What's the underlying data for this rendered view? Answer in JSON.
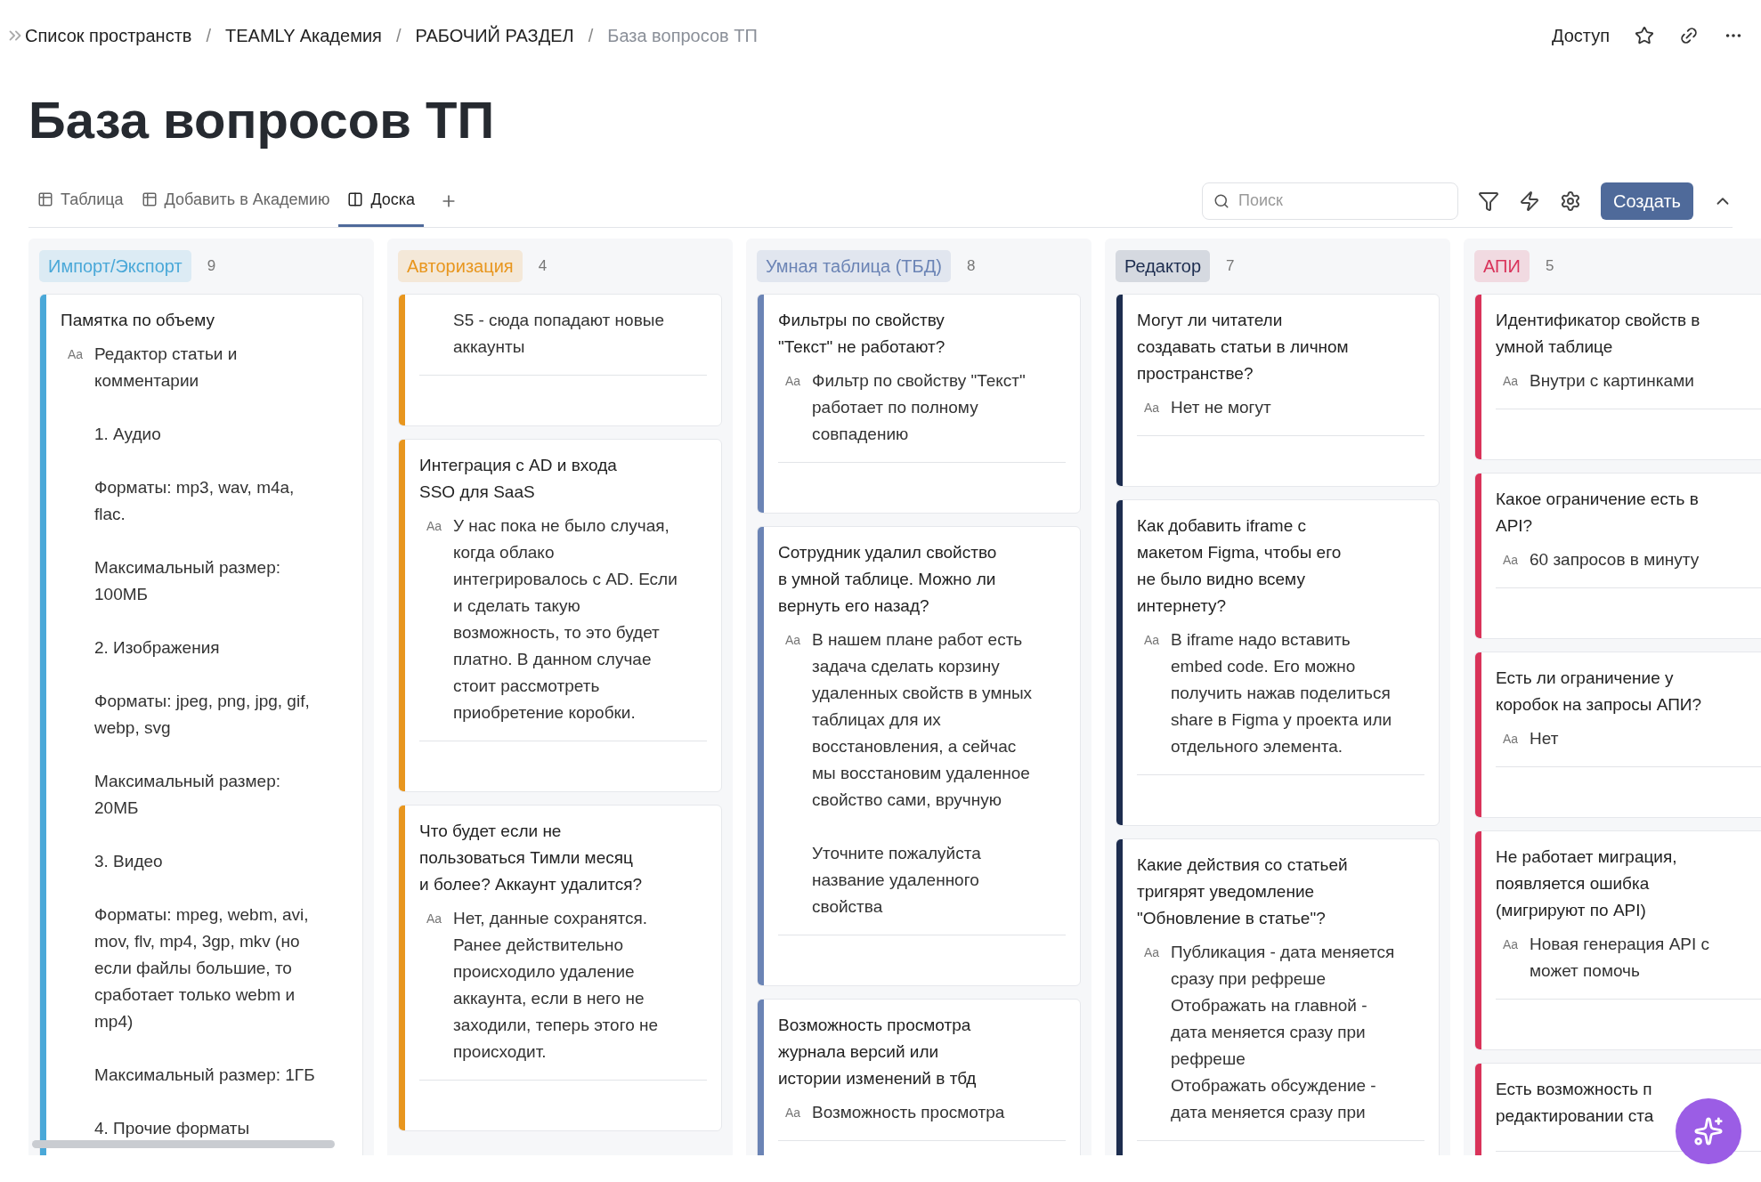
{
  "breadcrumbs": [
    {
      "label": "Список пространств",
      "current": false
    },
    {
      "label": "TEAMLY Академия",
      "current": false
    },
    {
      "label": "РАБОЧИЙ РАЗДЕЛ",
      "current": false
    },
    {
      "label": "База вопросов ТП",
      "current": true
    }
  ],
  "breadcrumb_separator": "/",
  "header_actions": {
    "access": "Доступ"
  },
  "title": "База вопросов ТП",
  "views": [
    {
      "label": "Таблица",
      "kind": "table",
      "selected": false
    },
    {
      "label": "Добавить в Академию",
      "kind": "table",
      "selected": false
    },
    {
      "label": "Доска",
      "kind": "board",
      "selected": true
    }
  ],
  "search": {
    "placeholder": "Поиск"
  },
  "create_button": "Создать",
  "columns": [
    {
      "label": "Импорт/Экспорт",
      "count": "9",
      "color": "#4aa8d8",
      "cards": [
        {
          "title": "Памятка по объему",
          "prop": "Aa",
          "body": "Редактор статьи и\nкомментарии\n\n1. Аудио\n\nФорматы: mp3, wav, m4a,\nflac.\n\nМаксимальный размер:\n100МБ\n\n2. Изображения\n\nФорматы: jpeg, png, jpg, gif,\nwebp, svg\n\nМаксимальный размер:\n20МБ\n\n3. Видео\n\nФорматы: mpeg, webm, avi,\nmov, flv, mp4, 3gp, mkv (но\nесли файлы большие, то\nсработает только webm и\nmp4)\n\nМаксимальный размер: 1ГБ\n\n4. Прочие форматы"
        }
      ]
    },
    {
      "label": "Авторизация",
      "count": "4",
      "color": "#e8961e",
      "cards": [
        {
          "body": "S5 - сюда попадают новые\nаккаунты"
        },
        {
          "title": "Интеграция с AD и входа\nSSO для SaaS",
          "prop": "Aa",
          "body": "У нас пока не было случая,\nкогда облако\nинтегрировалось с AD. Если\nи сделать такую\nвозможность, то это будет\nплатно. В данном случае\nстоит рассмотреть\nприобретение коробки."
        },
        {
          "title": "Что будет если не\nпользоваться Тимли месяц\nи более? Аккаунт удалится?",
          "prop": "Aa",
          "body": "Нет, данные сохранятся.\nРанее действительно\nпроисходило удаление\nаккаунта, если в него не\nзаходили, теперь этого не\nпроисходит."
        }
      ]
    },
    {
      "label": "Умная таблица (ТБД)",
      "count": "8",
      "color": "#6b84b5",
      "cards": [
        {
          "title": "Фильтры по свойству\n\"Текст\" не работают?",
          "prop": "Aa",
          "body": "Фильтр по свойству \"Текст\"\nработает по полному\nсовпадению"
        },
        {
          "title": "Сотрудник удалил свойство\nв умной таблице. Можно ли\nвернуть его назад?",
          "prop": "Aa",
          "body": "В нашем плане работ есть\nзадача сделать корзину\nудаленных свойств в умных\nтаблицах для их\nвосстановления, а сейчас\nмы восстановим удаленное\nсвойство сами, вручную\n\nУточните пожалуйста\nназвание удаленного\nсвойства"
        },
        {
          "title": "Возможность просмотра\nжурнала версий или\nистории изменений в тбд",
          "prop": "Aa",
          "body": "Возможность просмотра"
        }
      ]
    },
    {
      "label": "Редактор",
      "count": "7",
      "color": "#1d2d4f",
      "cards": [
        {
          "title": "Могут ли читатели\nсоздавать статьи в личном\nпространстве?",
          "prop": "Aa",
          "body": "Нет не могут"
        },
        {
          "title": "Как добавить iframe с\nмакетом Figma, чтобы его\nне было видно всему\nинтернету?",
          "prop": "Aa",
          "body": "В iframe надо вставить\nembed code. Его можно\nполучить нажав поделиться\nshare в Figma у проекта или\nотдельного элемента."
        },
        {
          "title": "Какие действия со статьей\nтригярят уведомление\n\"Обновление в статье\"?",
          "prop": "Aa",
          "body": "Публикация - дата меняется\nсразу при рефреше\nОтображать на главной -\nдата меняется сразу при\nрефреше\nОтображать обсуждение -\nдата меняется сразу при"
        }
      ]
    },
    {
      "label": "АПИ",
      "count": "5",
      "color": "#d9335a",
      "cards": [
        {
          "title": "Идентификатор свойств в\nумной таблице",
          "prop": "Aa",
          "body": "Внутри с картинками"
        },
        {
          "title": "Какое ограничение есть в\nAPI?",
          "prop": "Aa",
          "body": "60 запросов в минуту"
        },
        {
          "title": "Есть ли ограничение у\nкоробок на запросы АПИ?",
          "prop": "Aa",
          "body": "Нет"
        },
        {
          "title": "Не работает миграция,\nпоявляется ошибка\n(мигрируют по API)",
          "prop": "Aa",
          "body": "Новая генерация API с\nможет помочь"
        },
        {
          "title": "Есть возможность п\nредактировании ста"
        }
      ]
    }
  ]
}
